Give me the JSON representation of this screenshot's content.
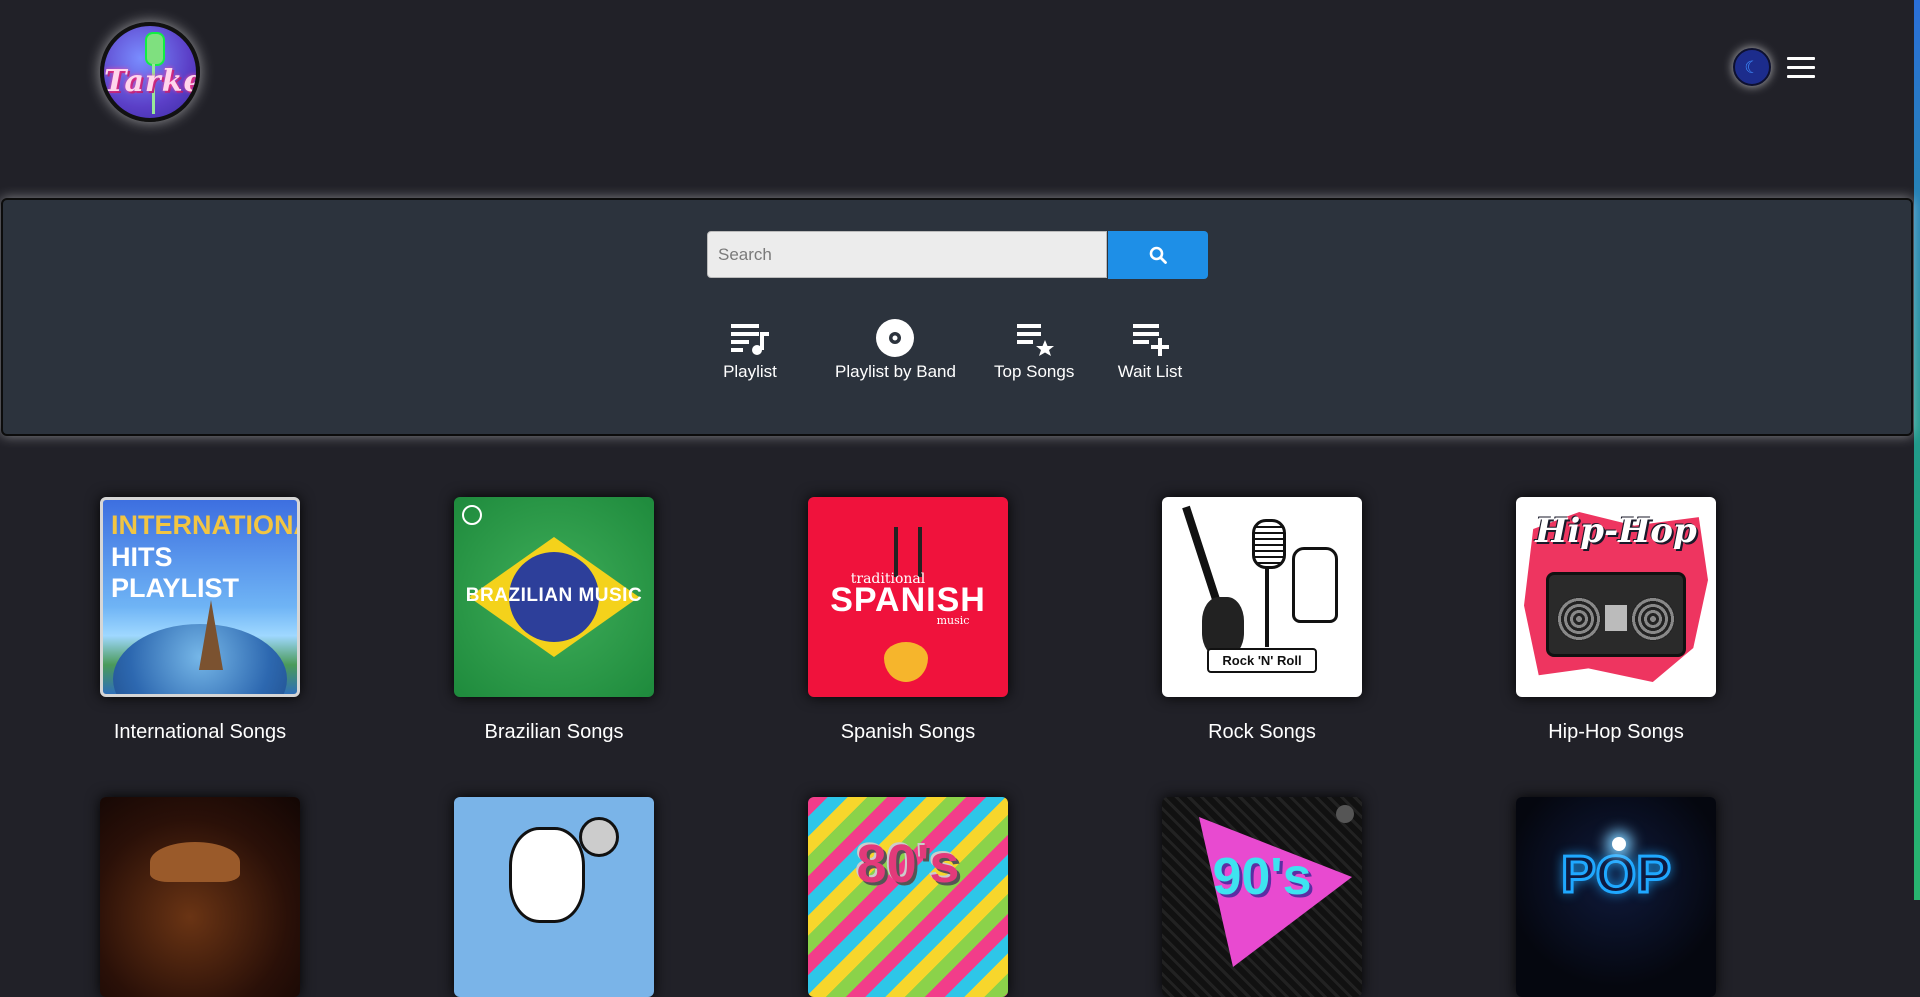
{
  "header": {
    "logo_text": "Tarke",
    "theme_toggle_icon": "moon-icon",
    "menu_icon": "hamburger-menu-icon"
  },
  "search": {
    "placeholder": "Search",
    "value": "",
    "button_icon": "search-icon",
    "accent_color": "#1e8fe7"
  },
  "quick_links": [
    {
      "label": "Playlist",
      "icon": "playlist-music-icon"
    },
    {
      "label": "Playlist by Band",
      "icon": "disc-icon"
    },
    {
      "label": "Top Songs",
      "icon": "playlist-star-icon"
    },
    {
      "label": "Wait List",
      "icon": "playlist-add-icon"
    }
  ],
  "categories": [
    {
      "title": "International Songs",
      "cover_text": [
        "INTERNATIONAL",
        "HITS",
        "PLAYLIST"
      ]
    },
    {
      "title": "Brazilian Songs",
      "cover_text": [
        "BRAZILIAN MUSIC"
      ]
    },
    {
      "title": "Spanish Songs",
      "cover_text": [
        "traditional",
        "SPANISH",
        "music"
      ]
    },
    {
      "title": "Rock Songs",
      "cover_text": [
        "Rock 'N' Roll"
      ]
    },
    {
      "title": "Hip-Hop Songs",
      "cover_text": [
        "Hip-Hop"
      ]
    }
  ],
  "categories_row2": [
    {
      "cover_text": []
    },
    {
      "cover_text": []
    },
    {
      "cover_text": [
        "80's"
      ]
    },
    {
      "cover_text": [
        "90's"
      ]
    },
    {
      "cover_text": [
        "POP"
      ]
    }
  ],
  "colors": {
    "background": "#212128",
    "panel": "#2c333d",
    "accent": "#1e8fe7"
  }
}
